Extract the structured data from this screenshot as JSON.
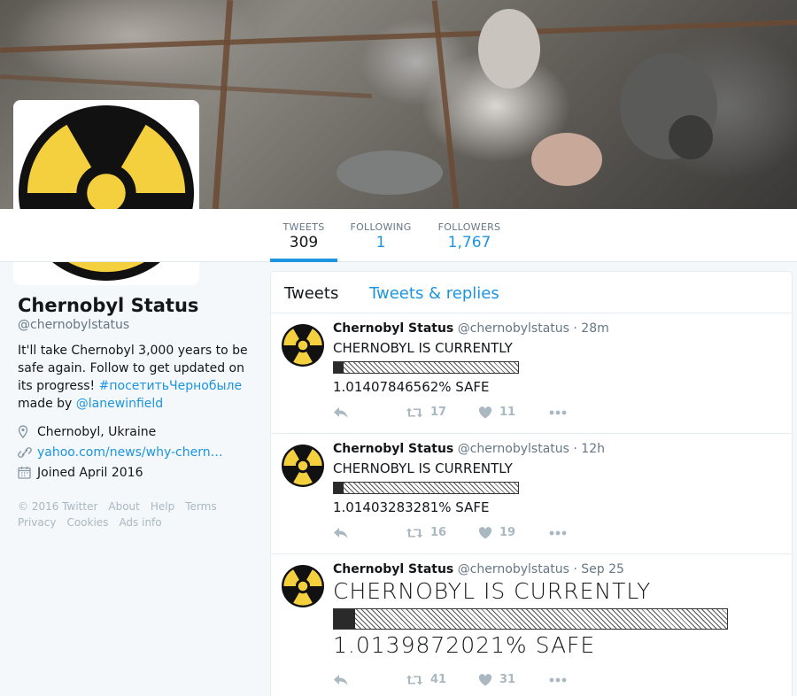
{
  "colors": {
    "accent": "#1b95e0",
    "radiation_yellow": "#f4d03f",
    "text": "#14171a",
    "muted": "#657786"
  },
  "profile": {
    "name": "Chernobyl Status",
    "handle": "@chernobylstatus",
    "bio_text": "It'll take Chernobyl 3,000 years to be safe again. Follow to get updated on its progress!",
    "bio_hashtag": "#посетитьЧернобыле",
    "made_by_label": "made by",
    "made_by_link": "@lanewinfield",
    "location": "Chernobyl, Ukraine",
    "website": "yahoo.com/news/why-chern…",
    "joined": "Joined April 2016",
    "icons": {
      "location": "location-pin-icon",
      "website": "link-icon",
      "joined": "calendar-icon"
    }
  },
  "stats": [
    {
      "label": "TWEETS",
      "value": "309"
    },
    {
      "label": "FOLLOWING",
      "value": "1"
    },
    {
      "label": "FOLLOWERS",
      "value": "1,767"
    }
  ],
  "footer": {
    "row1": [
      "© 2016 Twitter",
      "About",
      "Help",
      "Terms"
    ],
    "row2": [
      "Privacy",
      "Cookies",
      "Ads info"
    ]
  },
  "timeline": {
    "tabs": [
      "Tweets",
      "Tweets & replies"
    ],
    "tweets": [
      {
        "name": "Chernobyl Status",
        "handle": "@chernobylstatus",
        "time": "· 28m",
        "line1": "CHERNOBYL IS CURRENTLY",
        "line3": "1.01407846562% SAFE",
        "progress_percent": 1.01407846562,
        "retweets": "17",
        "likes": "11"
      },
      {
        "name": "Chernobyl Status",
        "handle": "@chernobylstatus",
        "time": "· 12h",
        "line1": "CHERNOBYL IS CURRENTLY",
        "line3": "1.01403283281% SAFE",
        "progress_percent": 1.01403283281,
        "retweets": "16",
        "likes": "19"
      },
      {
        "name": "Chernobyl Status",
        "handle": "@chernobylstatus",
        "time": "· Sep 25",
        "line1": "CHERNOBYL IS CURRENTLY",
        "line3": "1.0139872021% SAFE",
        "progress_percent": 1.0139872021,
        "retweets": "41",
        "likes": "31"
      }
    ]
  }
}
